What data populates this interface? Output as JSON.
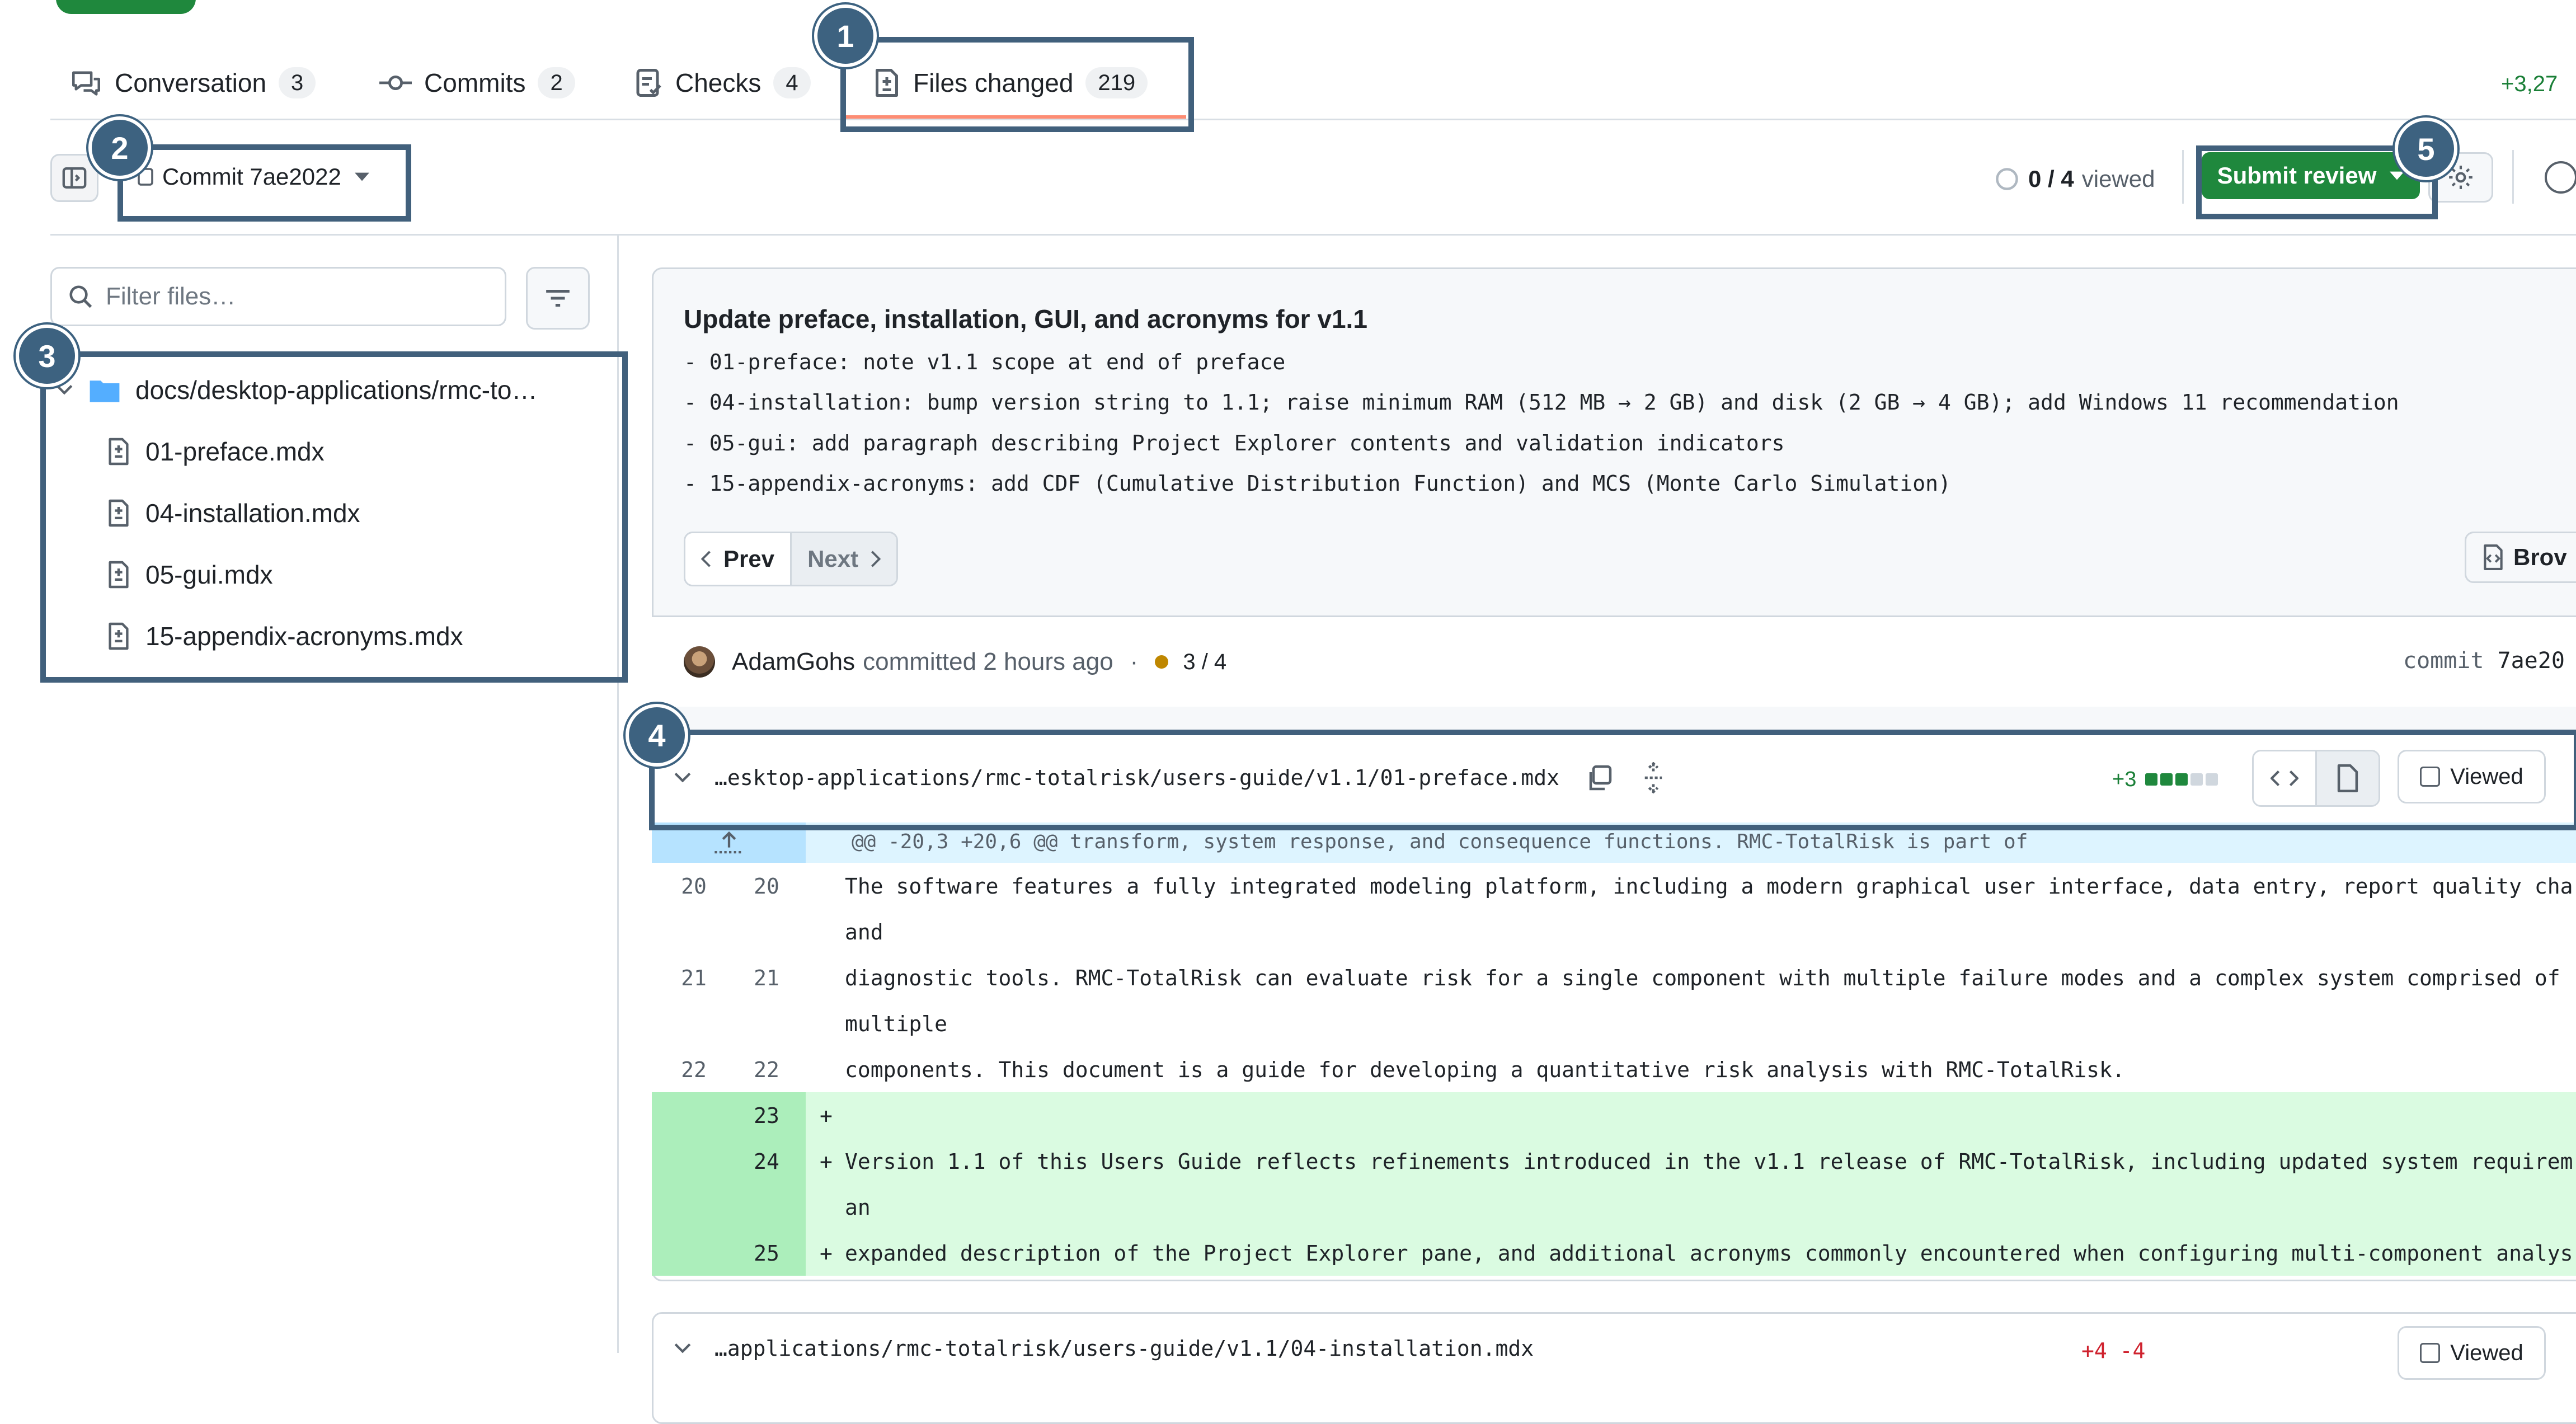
{
  "tabs": [
    {
      "label": "Conversation",
      "count": "3",
      "icon": "comment-discussion-icon"
    },
    {
      "label": "Commits",
      "count": "2",
      "icon": "git-commit-icon"
    },
    {
      "label": "Checks",
      "count": "4",
      "icon": "checklist-icon"
    },
    {
      "label": "Files changed",
      "count": "219",
      "icon": "file-diff-icon"
    }
  ],
  "diffstat": "+3,27",
  "toolbar": {
    "commit_label": "Commit 7ae2022",
    "viewed_count": "0 / 4",
    "viewed_label": "viewed",
    "submit_label": "Submit review"
  },
  "filter": {
    "placeholder": "Filter files…"
  },
  "file_tree": {
    "folder": "docs/desktop-applications/rmc-to…",
    "files": [
      "01-preface.mdx",
      "04-installation.mdx",
      "05-gui.mdx",
      "15-appendix-acronyms.mdx"
    ]
  },
  "commit": {
    "title": "Update preface, installation, GUI, and acronyms for v1.1",
    "body": [
      "- 01-preface: note v1.1 scope at end of preface",
      "- 04-installation: bump version string to 1.1; raise minimum RAM (512 MB → 2 GB) and disk (2 GB → 4 GB); add Windows 11 recommendation",
      "- 05-gui: add paragraph describing Project Explorer contents and validation indicators",
      "- 15-appendix-acronyms: add CDF (Cumulative Distribution Function) and MCS (Monte Carlo Simulation)"
    ],
    "prev_label": "Prev",
    "next_label": "Next",
    "browse_label": "Brov",
    "author": "AdamGohs",
    "committed_text": "committed 2 hours ago",
    "separator": "·",
    "checks": "3 / 4",
    "commit_label": "commit",
    "sha": "7ae20"
  },
  "file_header": {
    "path": "…esktop-applications/rmc-totalrisk/users-guide/v1.1/01-preface.mdx",
    "additions": "+3",
    "viewed_label": "Viewed"
  },
  "diff": {
    "hunk": "@@ -20,3 +20,6 @@ transform, system response, and consequence functions. RMC-TotalRisk is part of",
    "lines": [
      {
        "old": "20",
        "new": "20",
        "sign": "",
        "text": "The software features a fully integrated modeling platform, including a modern graphical user interface, data entry, report quality cha",
        "type": "context"
      },
      {
        "old": "",
        "new": "",
        "sign": "",
        "text": "and",
        "type": "context"
      },
      {
        "old": "21",
        "new": "21",
        "sign": "",
        "text": "diagnostic tools. RMC-TotalRisk can evaluate risk for a single component with multiple failure modes and a complex system comprised of",
        "type": "context"
      },
      {
        "old": "",
        "new": "",
        "sign": "",
        "text": "multiple",
        "type": "context"
      },
      {
        "old": "22",
        "new": "22",
        "sign": "",
        "text": "components. This document is a guide for developing a quantitative risk analysis with RMC-TotalRisk.",
        "type": "context"
      },
      {
        "old": "",
        "new": "23",
        "sign": "+",
        "text": "",
        "type": "add"
      },
      {
        "old": "",
        "new": "24",
        "sign": "+",
        "text": "Version 1.1 of this Users Guide reflects refinements introduced in the v1.1 release of RMC-TotalRisk, including updated system requirem",
        "type": "add"
      },
      {
        "old": "",
        "new": "",
        "sign": "",
        "text": "an",
        "type": "add"
      },
      {
        "old": "",
        "new": "25",
        "sign": "+",
        "text": "expanded description of the Project Explorer pane, and additional acronyms commonly encountered when configuring multi-component analys",
        "type": "add"
      }
    ]
  },
  "next_file": {
    "path": "…applications/rmc-totalrisk/users-guide/v1.1/04-installation.mdx",
    "stats": "+4 -4",
    "viewed_label": "Viewed"
  },
  "callouts": [
    "1",
    "2",
    "3",
    "4",
    "5"
  ],
  "colors": {
    "accent_green": "#1f883d",
    "add_bg": "#dafbe1",
    "add_num_bg": "#aceebb",
    "hunk_bg": "#ddf4ff",
    "callout": "#3d6280",
    "link_blue": "#54aeff"
  }
}
